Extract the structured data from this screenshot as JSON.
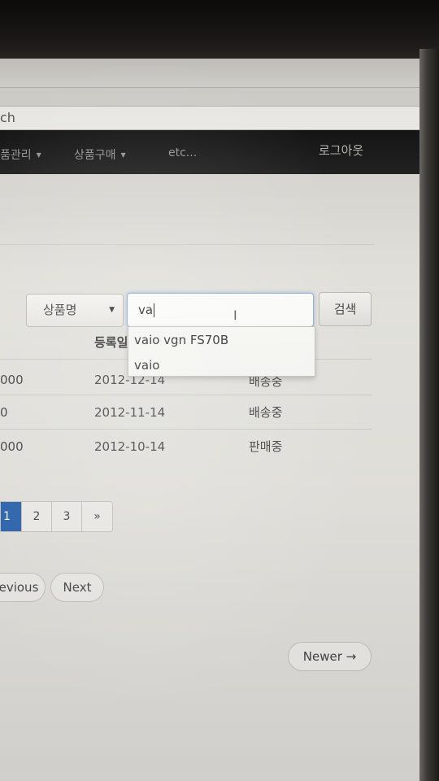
{
  "browser": {
    "address_partial": "ch"
  },
  "navbar": {
    "items": [
      {
        "label": "품관리"
      },
      {
        "label": "상품구매"
      },
      {
        "label": "etc..."
      }
    ],
    "logout": "로그아웃"
  },
  "search": {
    "select_value": "상품명",
    "input_value": "va",
    "button_label": "검색",
    "suggestions": [
      "vaio vgn FS70B",
      "vaio"
    ]
  },
  "table": {
    "date_header": "등록일",
    "rows": [
      {
        "price": "000",
        "date": "2012-12-14",
        "status": "배송중"
      },
      {
        "price": "0",
        "date": "2012-11-14",
        "status": "배송중"
      },
      {
        "price": "000",
        "date": "2012-10-14",
        "status": "판매중"
      }
    ]
  },
  "pagination": {
    "pages": [
      "1",
      "2",
      "3",
      "»"
    ],
    "active": "1"
  },
  "pager": {
    "previous": "evious",
    "next": "Next",
    "newer": "Newer →"
  },
  "colors": {
    "navbar_bg": "#1b1b1b",
    "active_page": "#2a64b0",
    "input_focus": "#8fb0d6"
  }
}
